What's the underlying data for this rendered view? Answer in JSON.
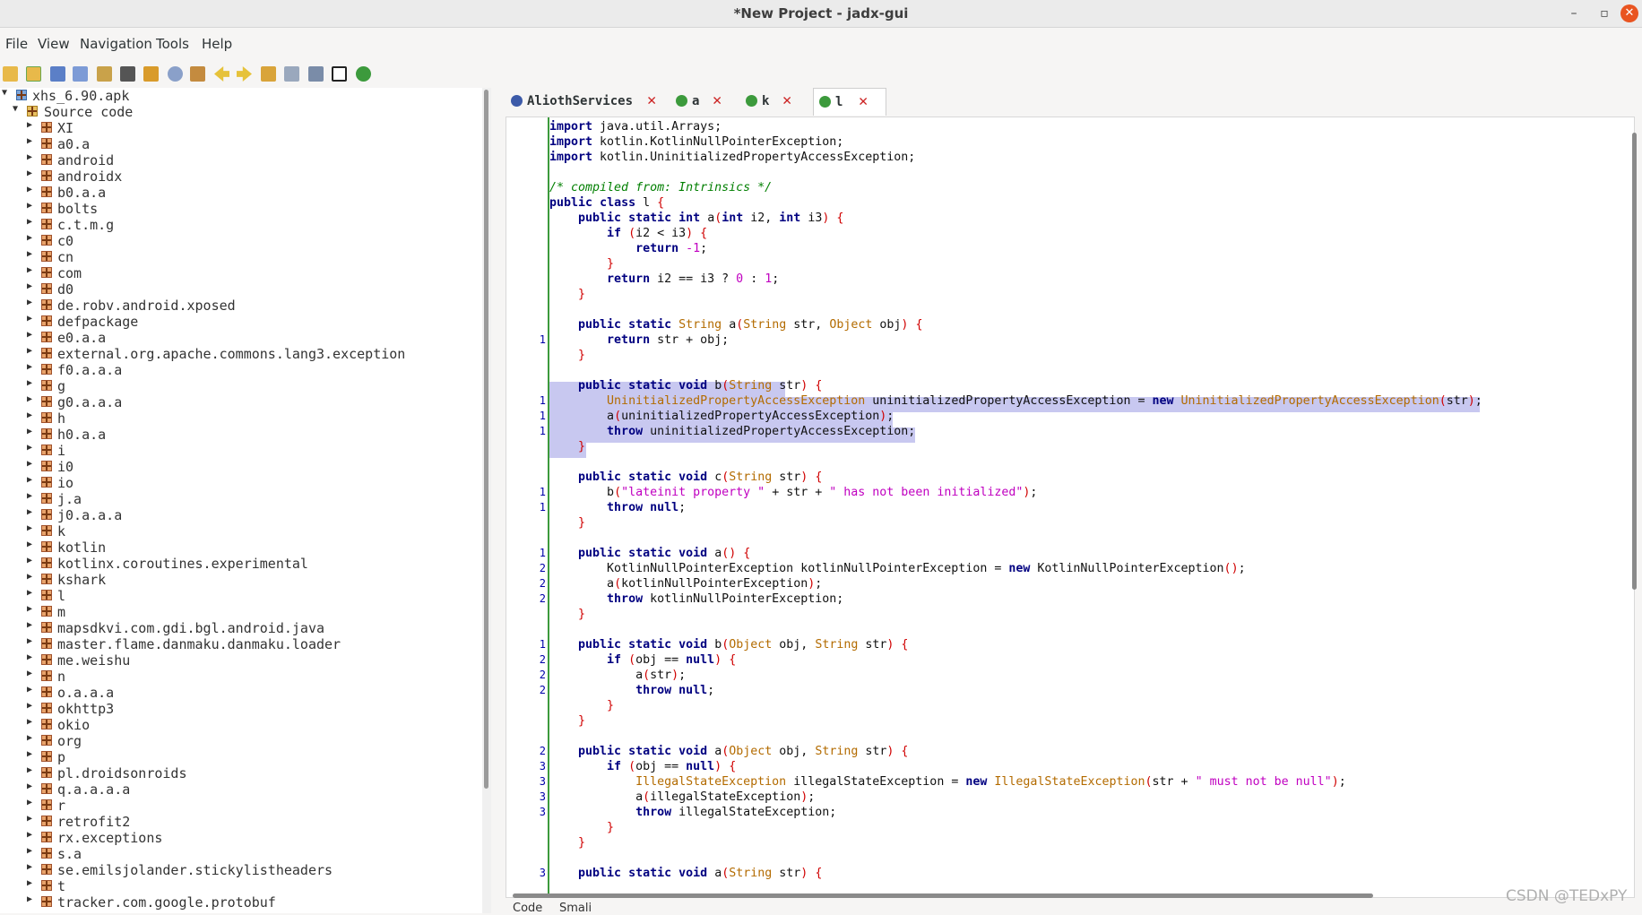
{
  "window": {
    "title": "*New Project - jadx-gui",
    "minimize": "–",
    "maximize": "▫",
    "close": "✕"
  },
  "menu": [
    {
      "label": "File"
    },
    {
      "label": "View"
    },
    {
      "label": "Navigation"
    },
    {
      "label": "Tools"
    },
    {
      "label": "Help"
    }
  ],
  "toolbar_icons": [
    "open-file-icon",
    "add-files-icon",
    "save-all-icon",
    "export-icon",
    "sync-icon",
    "flatten-packages-icon",
    "decompile-all-icon",
    "search-icon",
    "class-search-icon",
    "back-icon",
    "forward-icon",
    "deobfuscation-icon",
    "log-viewer-icon",
    "preferences-icon",
    "quark-icon",
    "debugger-icon"
  ],
  "tree": {
    "root": "xhs_6.90.apk",
    "source": "Source code",
    "packages": [
      "XI",
      "a0.a",
      "android",
      "androidx",
      "b0.a.a",
      "bolts",
      "c.t.m.g",
      "c0",
      "cn",
      "com",
      "d0",
      "de.robv.android.xposed",
      "defpackage",
      "e0.a.a",
      "external.org.apache.commons.lang3.exception",
      "f0.a.a.a",
      "g",
      "g0.a.a.a",
      "h",
      "h0.a.a",
      "i",
      "i0",
      "io",
      "j.a",
      "j0.a.a.a",
      "k",
      "kotlin",
      "kotlinx.coroutines.experimental",
      "kshark",
      "l",
      "m",
      "mapsdkvi.com.gdi.bgl.android.java",
      "master.flame.danmaku.danmaku.loader",
      "me.weishu",
      "n",
      "o.a.a.a",
      "okhttp3",
      "okio",
      "org",
      "p",
      "pl.droidsonroids",
      "q.a.a.a.a",
      "r",
      "retrofit2",
      "rx.exceptions",
      "s.a",
      "se.emilsjolander.stickylistheaders",
      "t",
      "tracker.com.google.protobuf"
    ]
  },
  "tabs": [
    {
      "label": "AliothServices",
      "icon": "interface-icon"
    },
    {
      "label": "a",
      "icon": "class-icon"
    },
    {
      "label": "k",
      "icon": "class-icon"
    },
    {
      "label": "l",
      "icon": "class-icon",
      "active": true
    }
  ],
  "code_lines": [
    {
      "n": "",
      "t": "import java.util.Arrays;"
    },
    {
      "n": "",
      "t": "import kotlin.KotlinNullPointerException;"
    },
    {
      "n": "",
      "t": "import kotlin.UninitializedPropertyAccessException;"
    },
    {
      "n": "",
      "t": ""
    },
    {
      "n": "",
      "t": "/* compiled from: Intrinsics */"
    },
    {
      "n": "",
      "t": "public class l {"
    },
    {
      "n": "",
      "t": "    public static int a(int i2, int i3) {"
    },
    {
      "n": "",
      "t": "        if (i2 < i3) {"
    },
    {
      "n": "",
      "t": "            return -1;"
    },
    {
      "n": "",
      "t": "        }"
    },
    {
      "n": "",
      "t": "        return i2 == i3 ? 0 : 1;"
    },
    {
      "n": "",
      "t": "    }"
    },
    {
      "n": "",
      "t": ""
    },
    {
      "n": "",
      "t": "    public static String a(String str, Object obj) {"
    },
    {
      "n": "1",
      "t": "        return str + obj;"
    },
    {
      "n": "",
      "t": "    }"
    },
    {
      "n": "",
      "t": ""
    },
    {
      "n": "",
      "t": "    public static void b(String str) {"
    },
    {
      "n": "1",
      "t": "        UninitializedPropertyAccessException uninitializedPropertyAccessException = new UninitializedPropertyAccessException(str);"
    },
    {
      "n": "1",
      "t": "        a(uninitializedPropertyAccessException);"
    },
    {
      "n": "1",
      "t": "        throw uninitializedPropertyAccessException;"
    },
    {
      "n": "",
      "t": "    }"
    },
    {
      "n": "",
      "t": ""
    },
    {
      "n": "",
      "t": "    public static void c(String str) {"
    },
    {
      "n": "1",
      "t": "        b(\"lateinit property \" + str + \" has not been initialized\");"
    },
    {
      "n": "1",
      "t": "        throw null;"
    },
    {
      "n": "",
      "t": "    }"
    },
    {
      "n": "",
      "t": ""
    },
    {
      "n": "1",
      "t": "    public static void a() {"
    },
    {
      "n": "2",
      "t": "        KotlinNullPointerException kotlinNullPointerException = new KotlinNullPointerException();"
    },
    {
      "n": "2",
      "t": "        a(kotlinNullPointerException);"
    },
    {
      "n": "2",
      "t": "        throw kotlinNullPointerException;"
    },
    {
      "n": "",
      "t": "    }"
    },
    {
      "n": "",
      "t": ""
    },
    {
      "n": "1",
      "t": "    public static void b(Object obj, String str) {"
    },
    {
      "n": "2",
      "t": "        if (obj == null) {"
    },
    {
      "n": "2",
      "t": "            a(str);"
    },
    {
      "n": "2",
      "t": "            throw null;"
    },
    {
      "n": "",
      "t": "        }"
    },
    {
      "n": "",
      "t": "    }"
    },
    {
      "n": "",
      "t": ""
    },
    {
      "n": "2",
      "t": "    public static void a(Object obj, String str) {"
    },
    {
      "n": "3",
      "t": "        if (obj == null) {"
    },
    {
      "n": "3",
      "t": "            IllegalStateException illegalStateException = new IllegalStateException(str + \" must not be null\");"
    },
    {
      "n": "3",
      "t": "            a(illegalStateException);"
    },
    {
      "n": "3",
      "t": "            throw illegalStateException;"
    },
    {
      "n": "",
      "t": "        }"
    },
    {
      "n": "",
      "t": "    }"
    },
    {
      "n": "",
      "t": ""
    },
    {
      "n": "3",
      "t": "    public static void a(String str) {"
    }
  ],
  "bottom_tabs": [
    {
      "label": "Code"
    },
    {
      "label": "Smali"
    }
  ],
  "watermark": "CSDN @TEDxPY"
}
